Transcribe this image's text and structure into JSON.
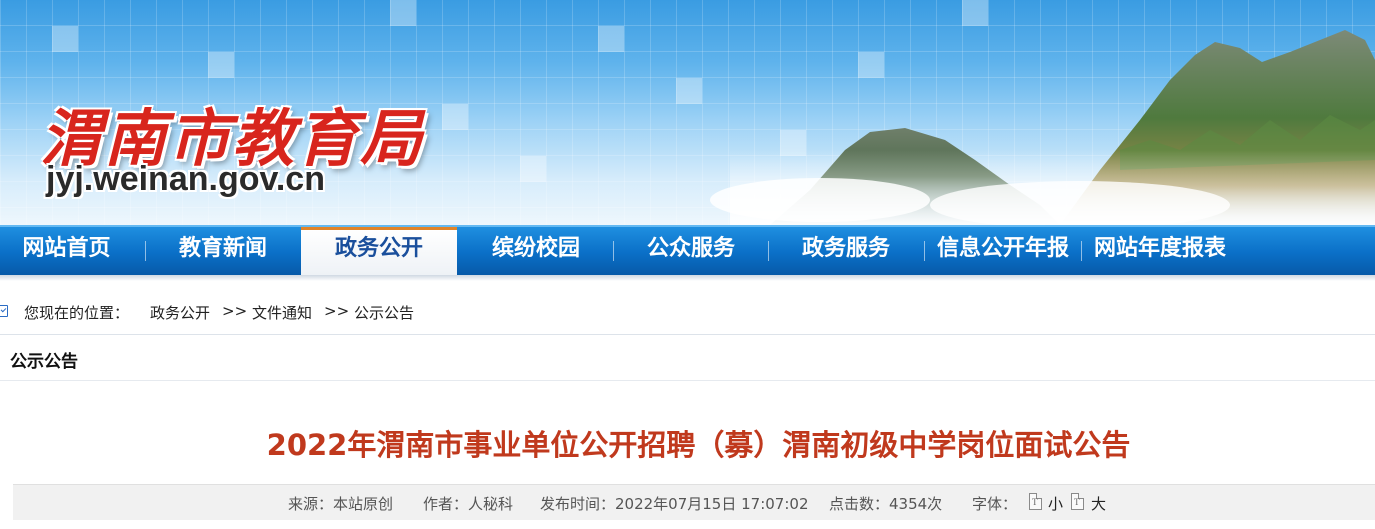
{
  "site": {
    "name": "渭南市教育局",
    "url": "jyj.weinan.gov.cn"
  },
  "nav": [
    {
      "label": "网站首页"
    },
    {
      "label": "教育新闻"
    },
    {
      "label": "政务公开",
      "active": true
    },
    {
      "label": "缤纷校园"
    },
    {
      "label": "公众服务"
    },
    {
      "label": "政务服务"
    },
    {
      "label": "信息公开年报"
    },
    {
      "label": "网站年度报表"
    }
  ],
  "breadcrumb": {
    "prefix": "您现在的位置：",
    "items": [
      "政务公开",
      ">>",
      "文件通知",
      ">>",
      "公示公告"
    ]
  },
  "section_title": "公示公告",
  "article": {
    "title": "2022年渭南市事业单位公开招聘（募）渭南初级中学岗位面试公告",
    "meta": {
      "source": "来源：本站原创",
      "author": "作者：人秘科",
      "published": "发布时间：2022年07月15日 17:07:02",
      "clicks": "点击数：4354次",
      "font_label": "字体：",
      "font_small": "小",
      "font_large": "大"
    }
  },
  "colors": {
    "nav_blue": "#0a6fc7",
    "title_red": "#c0391d",
    "logo_red": "#d8251d"
  },
  "icons": [
    "checkbox-icon",
    "font-small-icon",
    "font-large-icon"
  ]
}
